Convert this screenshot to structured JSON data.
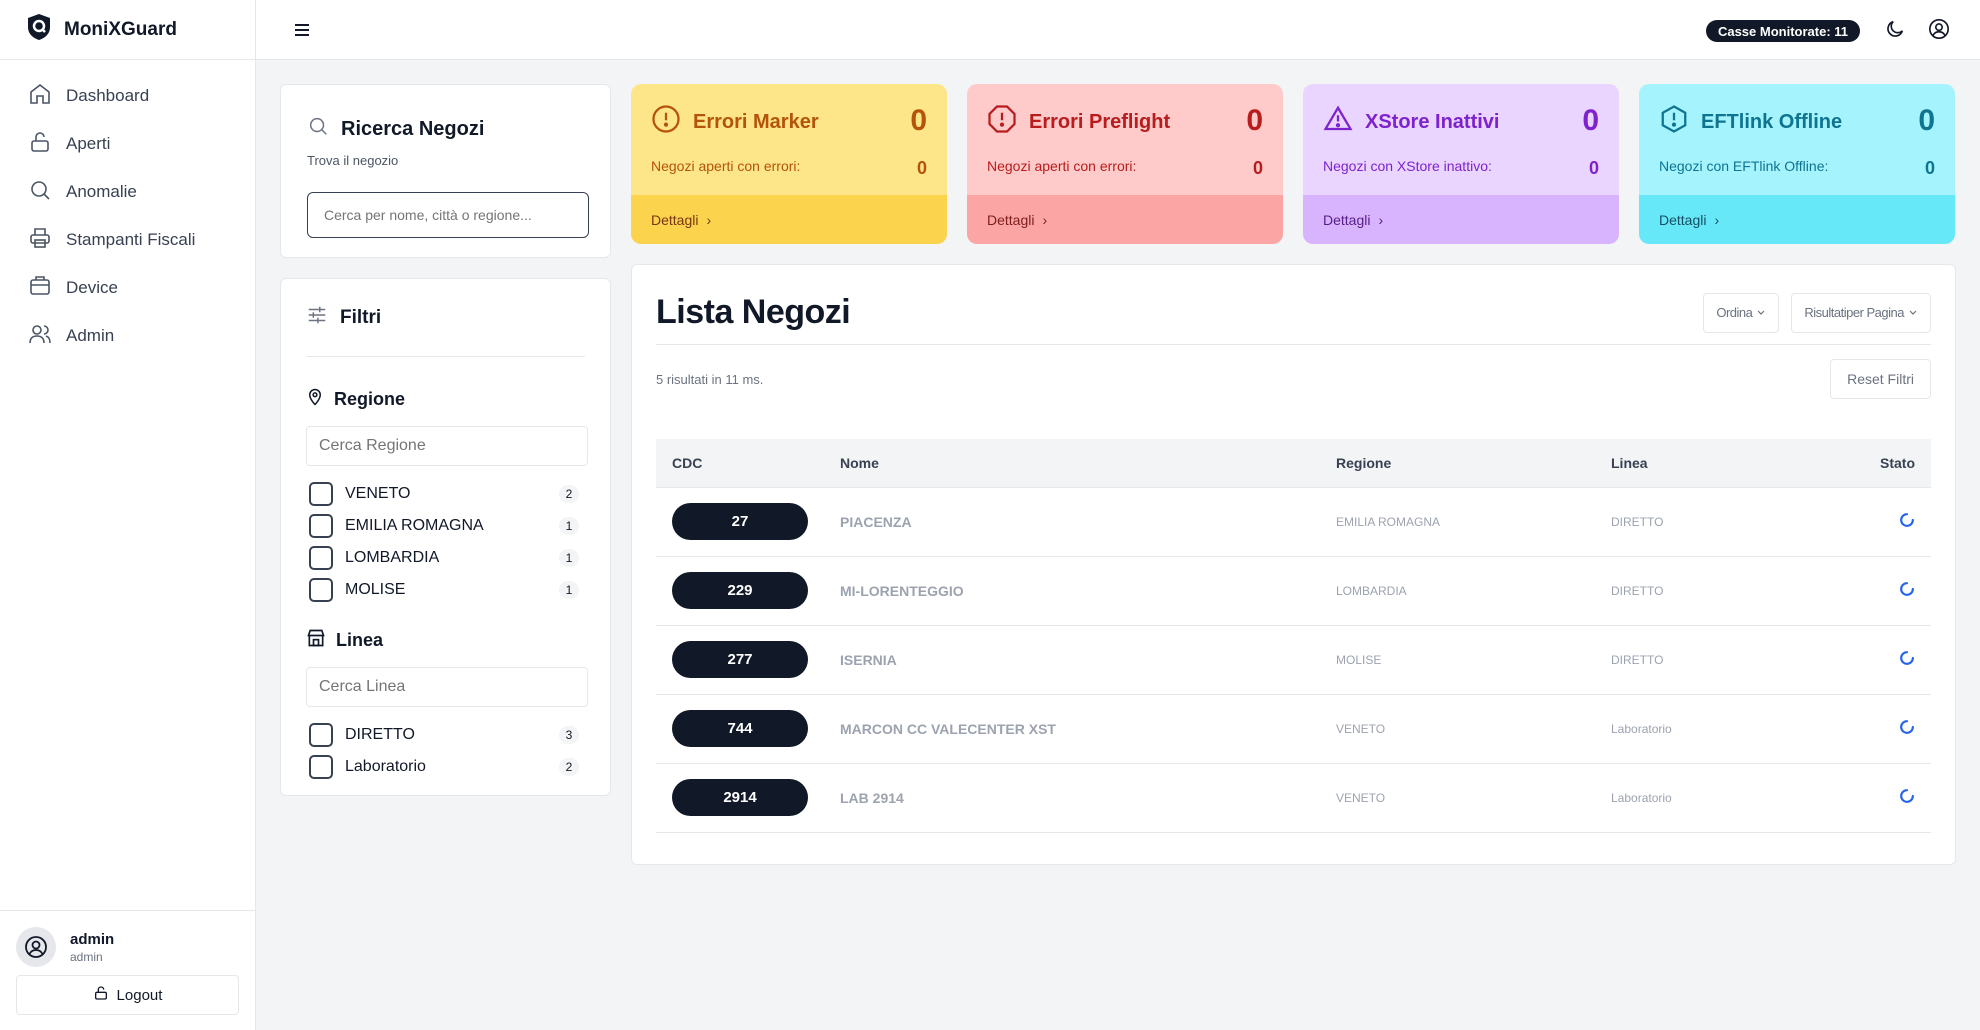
{
  "app": {
    "title": "MoniXGuard"
  },
  "sidebar": {
    "items": [
      {
        "label": "Dashboard",
        "icon": "home-icon"
      },
      {
        "label": "Aperti",
        "icon": "unlock-icon"
      },
      {
        "label": "Anomalie",
        "icon": "search-icon"
      },
      {
        "label": "Stampanti Fiscali",
        "icon": "printer-icon"
      },
      {
        "label": "Device",
        "icon": "box-icon"
      },
      {
        "label": "Admin",
        "icon": "users-icon"
      }
    ],
    "user": {
      "name": "admin",
      "role": "admin"
    },
    "logout_label": "Logout"
  },
  "topbar": {
    "casse_label": "Casse Monitorate: 11"
  },
  "search": {
    "title": "Ricerca Negozi",
    "subtitle": "Trova il negozio",
    "placeholder": "Cerca per nome, città o regione..."
  },
  "filters": {
    "title": "Filtri",
    "regione": {
      "label": "Regione",
      "placeholder": "Cerca Regione",
      "options": [
        {
          "label": "VENETO",
          "count": "2"
        },
        {
          "label": "EMILIA ROMAGNA",
          "count": "1"
        },
        {
          "label": "LOMBARDIA",
          "count": "1"
        },
        {
          "label": "MOLISE",
          "count": "1"
        }
      ]
    },
    "linea": {
      "label": "Linea",
      "placeholder": "Cerca Linea",
      "options": [
        {
          "label": "DIRETTO",
          "count": "3"
        },
        {
          "label": "Laboratorio",
          "count": "2"
        }
      ]
    }
  },
  "stats": [
    {
      "title": "Errori Marker",
      "value": "0",
      "desc": "Negozi aperti con errori:",
      "desc_value": "0",
      "link": "Dettagli",
      "colors": {
        "top": "#fde68a",
        "bot": "#fcd34d",
        "accent": "#b45309"
      }
    },
    {
      "title": "Errori Preflight",
      "value": "0",
      "desc": "Negozi aperti con errori:",
      "desc_value": "0",
      "link": "Dettagli",
      "colors": {
        "top": "#fecaca",
        "bot": "#fca5a5",
        "accent": "#b91c1c"
      }
    },
    {
      "title": "XStore Inattivi",
      "value": "0",
      "desc": "Negozi con XStore inattivo:",
      "desc_value": "0",
      "link": "Dettagli",
      "colors": {
        "top": "#e9d5ff",
        "bot": "#d8b4fe",
        "accent": "#7e22ce"
      }
    },
    {
      "title": "EFTlink Offline",
      "value": "0",
      "desc": "Negozi con EFTlink Offline:",
      "desc_value": "0",
      "link": "Dettagli",
      "colors": {
        "top": "#a5f3fc",
        "bot": "#67e8f9",
        "accent": "#0e7490"
      }
    }
  ],
  "list": {
    "title": "Lista Negozi",
    "sort_label": "Ordina",
    "per_page_label": "Risultatiper Pagina",
    "results_text": "5 risultati in 11 ms.",
    "reset_label": "Reset Filtri",
    "columns": [
      "CDC",
      "Nome",
      "Regione",
      "Linea",
      "Stato"
    ],
    "rows": [
      {
        "cdc": "27",
        "nome": "PIACENZA",
        "regione": "EMILIA ROMAGNA",
        "linea": "DIRETTO"
      },
      {
        "cdc": "229",
        "nome": "MI-LORENTEGGIO",
        "regione": "LOMBARDIA",
        "linea": "DIRETTO"
      },
      {
        "cdc": "277",
        "nome": "ISERNIA",
        "regione": "MOLISE",
        "linea": "DIRETTO"
      },
      {
        "cdc": "744",
        "nome": "MARCON CC VALECENTER XST",
        "regione": "VENETO",
        "linea": "Laboratorio"
      },
      {
        "cdc": "2914",
        "nome": "LAB 2914",
        "regione": "VENETO",
        "linea": "Laboratorio"
      }
    ]
  }
}
